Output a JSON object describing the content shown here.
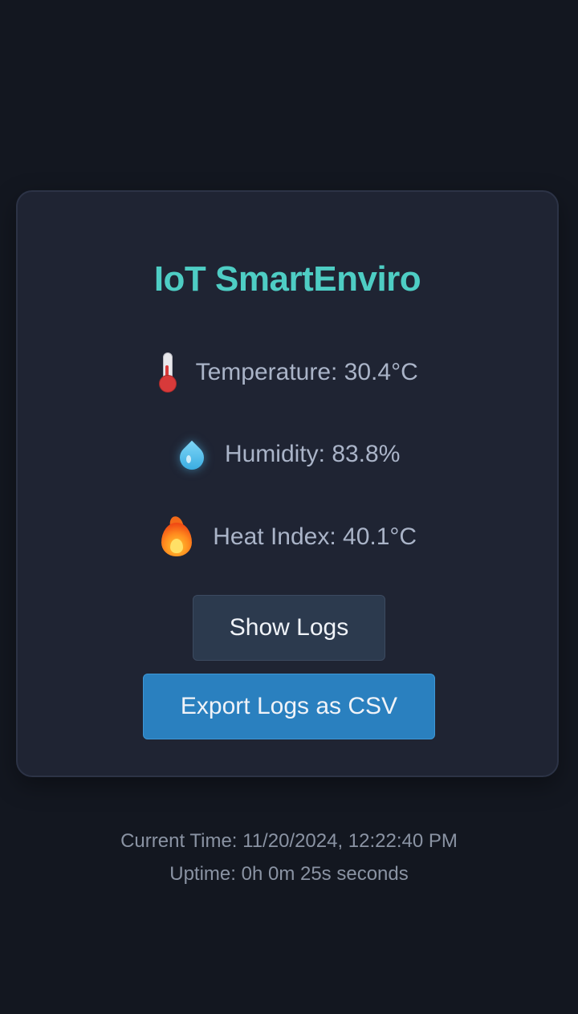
{
  "app": {
    "title": "IoT SmartEnviro"
  },
  "readings": {
    "temperature": {
      "icon": "thermometer-icon",
      "text": "Temperature: 30.4°C"
    },
    "humidity": {
      "icon": "water-droplet-icon",
      "text": "Humidity: 83.8%"
    },
    "heat_index": {
      "icon": "fire-icon",
      "text": "Heat Index: 40.1°C"
    }
  },
  "buttons": {
    "show_logs": "Show Logs",
    "export_csv": "Export Logs as CSV"
  },
  "footer": {
    "current_time": "Current Time: 11/20/2024, 12:22:40 PM",
    "uptime": "Uptime: 0h 0m 25s seconds"
  },
  "colors": {
    "background": "#131720",
    "card": "#1f2433",
    "title_accent": "#4ecdc4",
    "primary_button": "#2a80bf",
    "secondary_button": "#2c3a4e"
  }
}
